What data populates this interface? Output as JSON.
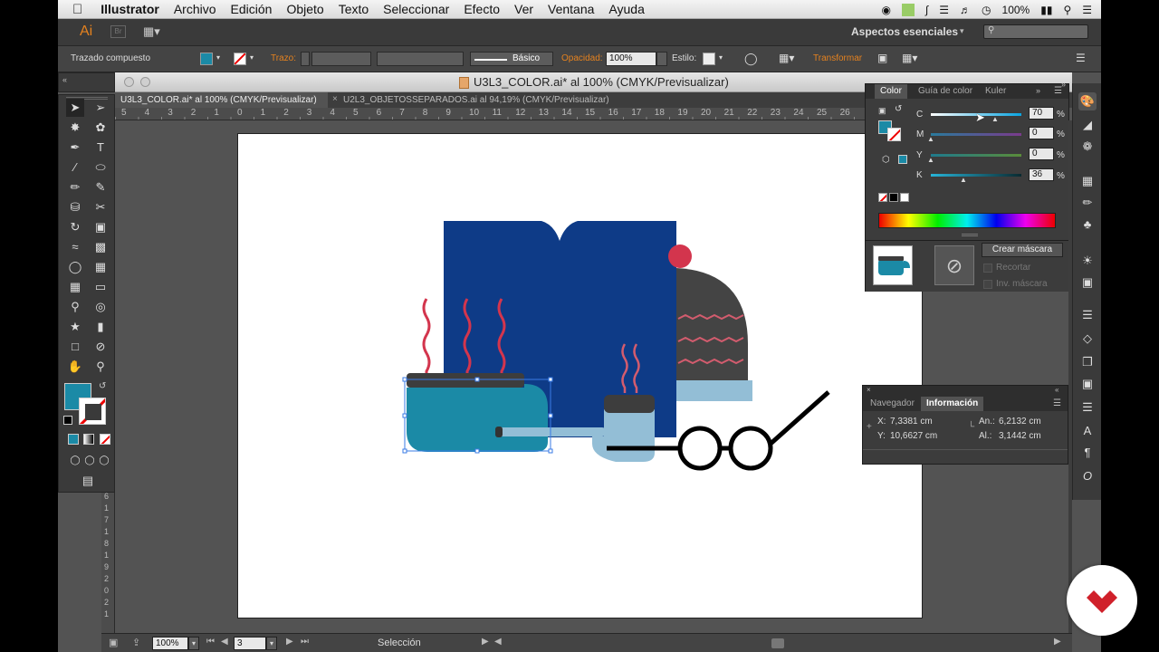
{
  "menubar": {
    "apple": "",
    "items": [
      "Illustrator",
      "Archivo",
      "Edición",
      "Objeto",
      "Texto",
      "Seleccionar",
      "Efecto",
      "Ver",
      "Ventana",
      "Ayuda"
    ],
    "battery": "100%"
  },
  "appbar": {
    "logo": "Ai",
    "bridge": "Br",
    "workspace": "Aspectos esenciales"
  },
  "control": {
    "object_type": "Trazado compuesto",
    "fill_color": "#1b8aa6",
    "stroke_label": "Trazo:",
    "stroke_profile": "Básico",
    "opacity_label": "Opacidad:",
    "opacity_value": "100%",
    "style_label": "Estilo:",
    "transform_label": "Transformar"
  },
  "document": {
    "window_title": "U3L3_COLOR.ai* al 100% (CMYK/Previsualizar)",
    "tabs": [
      {
        "label": "U3L3_COLOR.ai* al 100% (CMYK/Previsualizar)",
        "active": true
      },
      {
        "label": "U2L3_OBJETOSSEPARADOS.ai al 94,19% (CMYK/Previsualizar)",
        "active": false
      }
    ],
    "ruler_h": [
      "5",
      "4",
      "3",
      "2",
      "1",
      "0",
      "1",
      "2",
      "3",
      "4",
      "5",
      "6",
      "7",
      "8",
      "9",
      "10",
      "11",
      "12",
      "13",
      "14",
      "15",
      "16",
      "17",
      "18",
      "19",
      "20",
      "21",
      "22",
      "23",
      "24",
      "25",
      "26"
    ],
    "ruler_v": [
      "6",
      "1",
      "7",
      "1",
      "8",
      "1",
      "9",
      "2",
      "0",
      "2",
      "1"
    ]
  },
  "color_panel": {
    "tabs": [
      "Color",
      "Guía de color",
      "Kuler"
    ],
    "channels": [
      {
        "name": "C",
        "value": "70",
        "unit": "%"
      },
      {
        "name": "M",
        "value": "0",
        "unit": "%"
      },
      {
        "name": "Y",
        "value": "0",
        "unit": "%"
      },
      {
        "name": "K",
        "value": "36",
        "unit": "%"
      }
    ],
    "colors": {
      "fill": "#1b8aa6"
    }
  },
  "mask_panel": {
    "create_mask": "Crear máscara",
    "clip": "Recortar",
    "invert": "Inv. máscara"
  },
  "info_panel": {
    "tabs": [
      "Navegador",
      "Información"
    ],
    "x_label": "X:",
    "x_value": "7,3381 cm",
    "y_label": "Y:",
    "y_value": "10,6627 cm",
    "w_label": "An.:",
    "w_value": "6,2132 cm",
    "h_label": "Al.:",
    "h_value": "3,1442 cm"
  },
  "status": {
    "zoom": "100%",
    "artboard_num": "3",
    "tool_name": "Selección"
  }
}
